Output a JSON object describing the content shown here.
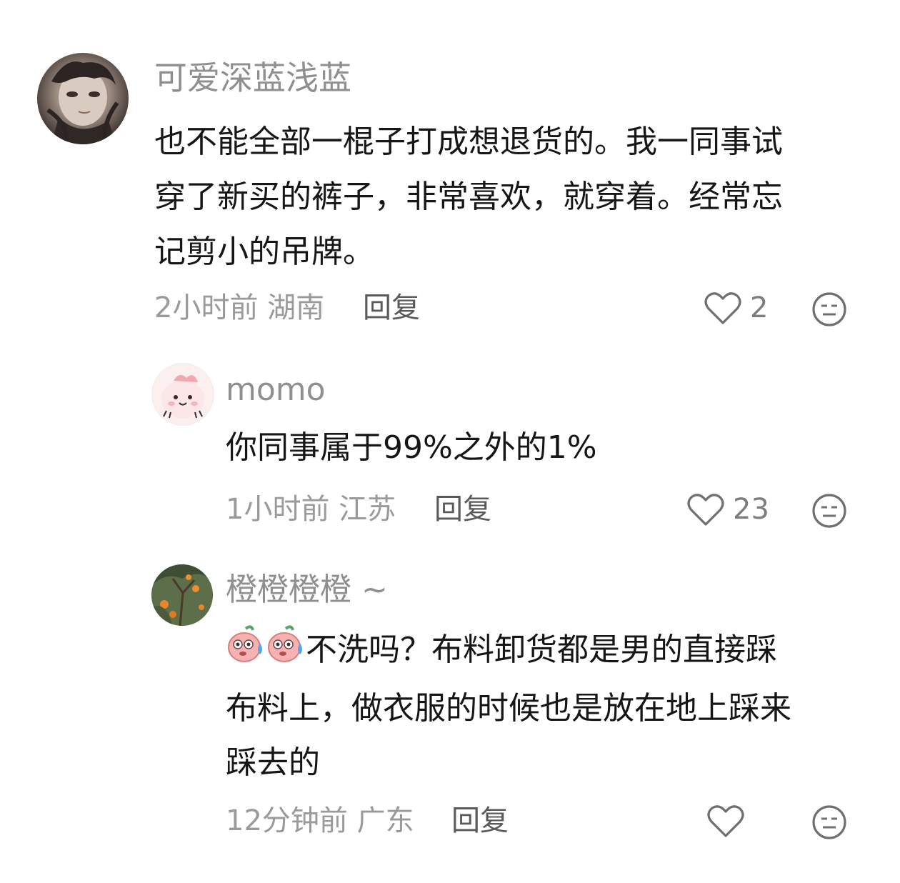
{
  "comments": [
    {
      "username": "可爱深蓝浅蓝",
      "text_lines": [
        "也不能全部一棍子打成想退货的。我一同事试",
        "穿了新买的裤子，非常喜欢，就穿着。经常忘",
        "记剪小的吊牌。"
      ],
      "time_location": "2小时前 湖南",
      "reply_label": "回复",
      "likes": "2",
      "avatar_icon": "woman-portrait-avatar"
    },
    {
      "username": "momo",
      "text_lines": [
        "你同事属于99%之外的1%"
      ],
      "time_location": "1小时前 江苏",
      "reply_label": "回复",
      "likes": "23",
      "avatar_icon": "pink-cartoon-avatar"
    },
    {
      "username": "橙橙橙橙 ~",
      "text_lines": [
        "不洗吗？布料卸货都是男的直接踩",
        "布料上，做衣服的时候也是放在地上踩来",
        "踩去的"
      ],
      "emoji_icon": "sweating-peach-emoji",
      "emoji_count": 2,
      "time_location": "12分钟前 广东",
      "reply_label": "回复",
      "likes": "",
      "avatar_icon": "orange-tree-avatar"
    }
  ],
  "colors": {
    "username": "#8f8f8f",
    "text": "#161616",
    "meta": "#9a9a9a",
    "reply": "#5a5a5a",
    "icon": "#6f6f6f"
  }
}
